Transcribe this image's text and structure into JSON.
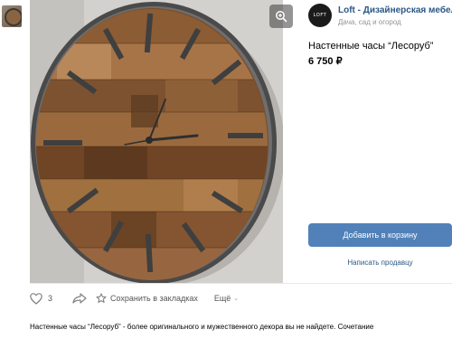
{
  "seller": {
    "logo_text": "LOFT",
    "name": "Loft - Дизайнерская мебель на",
    "description": "Дача, сад и огород"
  },
  "product": {
    "title": "Настенные часы “Лесоруб”",
    "price": "6 750 ₽"
  },
  "buttons": {
    "add_to_cart": "Добавить в корзину",
    "write_seller": "Написать продавцу"
  },
  "actions": {
    "like_count": "3",
    "bookmark_label": "Сохранить в закладках",
    "more_label": "Ещё"
  },
  "description_text": "Настенные часы “Лесоруб” - более оригинального и мужественного декора вы не найдете. Сочетание",
  "colors": {
    "accent": "#5181b8",
    "link": "#2a5885",
    "muted": "#939393"
  },
  "icons": [
    "zoom-icon",
    "like-icon",
    "share-icon",
    "bookmark-icon",
    "chevron-down-icon"
  ]
}
